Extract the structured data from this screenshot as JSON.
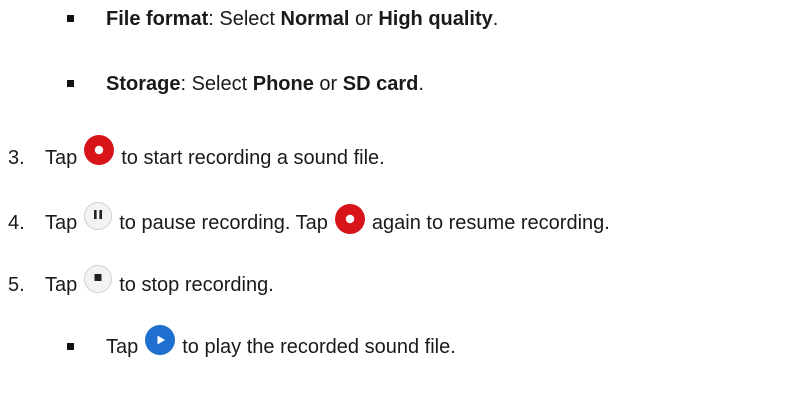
{
  "bullets_top": [
    {
      "label": "File format",
      "sep": ": Select ",
      "opt1": "Normal",
      "or": " or ",
      "opt2": "High quality",
      "end": "."
    },
    {
      "label": "Storage",
      "sep": ": Select ",
      "opt1": "Phone",
      "or": " or ",
      "opt2": "SD card",
      "end": "."
    }
  ],
  "steps": [
    {
      "number": "3.",
      "tap": "Tap",
      "icon": "record-icon",
      "text": "to start recording a sound file."
    },
    {
      "number": "4.",
      "tap": "Tap",
      "icon": "pause-icon",
      "text_a": "to pause recording. Tap",
      "icon2": "record-icon",
      "text_b": "again to resume recording."
    },
    {
      "number": "5.",
      "tap": "Tap",
      "icon": "stop-icon",
      "text": "to stop recording."
    }
  ],
  "sub_bullet": {
    "tap": "Tap",
    "icon": "play-icon",
    "text": "to play the recorded sound file."
  },
  "colors": {
    "record": "#d7141a",
    "play": "#1f6fd1",
    "neutral_icon_bg": "#e8e8e8",
    "text": "#1a1a1a"
  }
}
